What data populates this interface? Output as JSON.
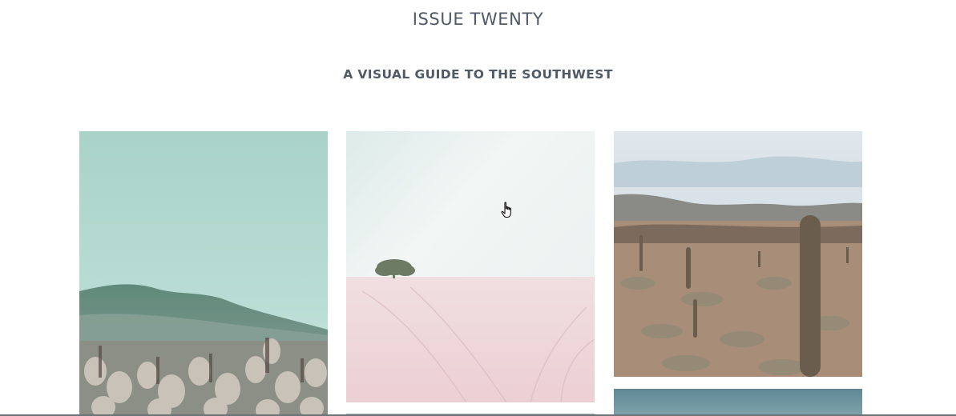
{
  "header": {
    "title": "ISSUE TWENTY",
    "subtitle": "A VISUAL GUIDE TO THE SOUTHWEST"
  },
  "gallery": {
    "photos": [
      {
        "subject": "teal sky over mountains with cholla cactus field"
      },
      {
        "subject": "pale pink desert with lone tree"
      },
      {
        "subject": "saguaro cactus desert valley"
      },
      {
        "subject": "teal sky landscape (partially visible)"
      },
      {
        "subject": "photo (partially visible)"
      }
    ]
  },
  "colors": {
    "text": "#4f5a66",
    "background": "#ffffff"
  },
  "cursor": {
    "icon": "hand-pointer-icon"
  }
}
